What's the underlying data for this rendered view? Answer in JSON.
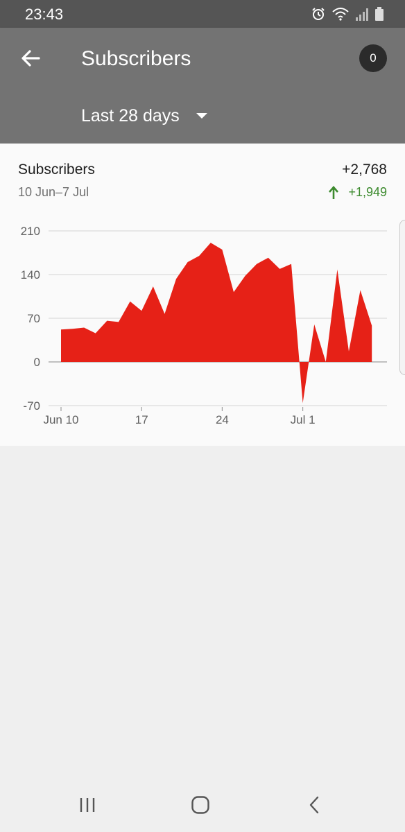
{
  "status_bar": {
    "time": "23:43",
    "icons": [
      "alarm-icon",
      "wifi-icon",
      "signal-icon",
      "battery-icon"
    ]
  },
  "app_bar": {
    "title": "Subscribers",
    "badge_count": "0",
    "period": "Last 28 days"
  },
  "summary": {
    "title": "Subscribers",
    "date_range": "10 Jun–7 Jul",
    "total": "+2,768",
    "change": "+1,949",
    "change_direction": "up"
  },
  "colors": {
    "area": "#e62117",
    "positive": "#3c8a2e",
    "app_bar": "#737373",
    "status_bar": "#555555"
  },
  "chart_data": {
    "type": "area",
    "title": "",
    "xlabel": "",
    "ylabel": "",
    "x": [
      "10 Jun",
      "11 Jun",
      "12 Jun",
      "13 Jun",
      "14 Jun",
      "15 Jun",
      "16 Jun",
      "17 Jun",
      "18 Jun",
      "19 Jun",
      "20 Jun",
      "21 Jun",
      "22 Jun",
      "23 Jun",
      "24 Jun",
      "25 Jun",
      "26 Jun",
      "27 Jun",
      "28 Jun",
      "29 Jun",
      "30 Jun",
      "1 Jul",
      "2 Jul",
      "3 Jul",
      "4 Jul",
      "5 Jul",
      "6 Jul",
      "7 Jul"
    ],
    "values": [
      52,
      53,
      55,
      46,
      66,
      64,
      97,
      82,
      121,
      77,
      133,
      160,
      170,
      191,
      180,
      112,
      138,
      157,
      167,
      149,
      157,
      -66,
      60,
      0,
      148,
      17,
      115,
      58
    ],
    "x_ticks": [
      "Jun 10",
      "17",
      "24",
      "Jul 1"
    ],
    "y_ticks": [
      210,
      140,
      70,
      0,
      -70
    ],
    "ylim": [
      -70,
      210
    ],
    "grid": true
  },
  "nav_bar": {
    "buttons": [
      "recent-apps-icon",
      "home-icon",
      "back-icon"
    ]
  }
}
